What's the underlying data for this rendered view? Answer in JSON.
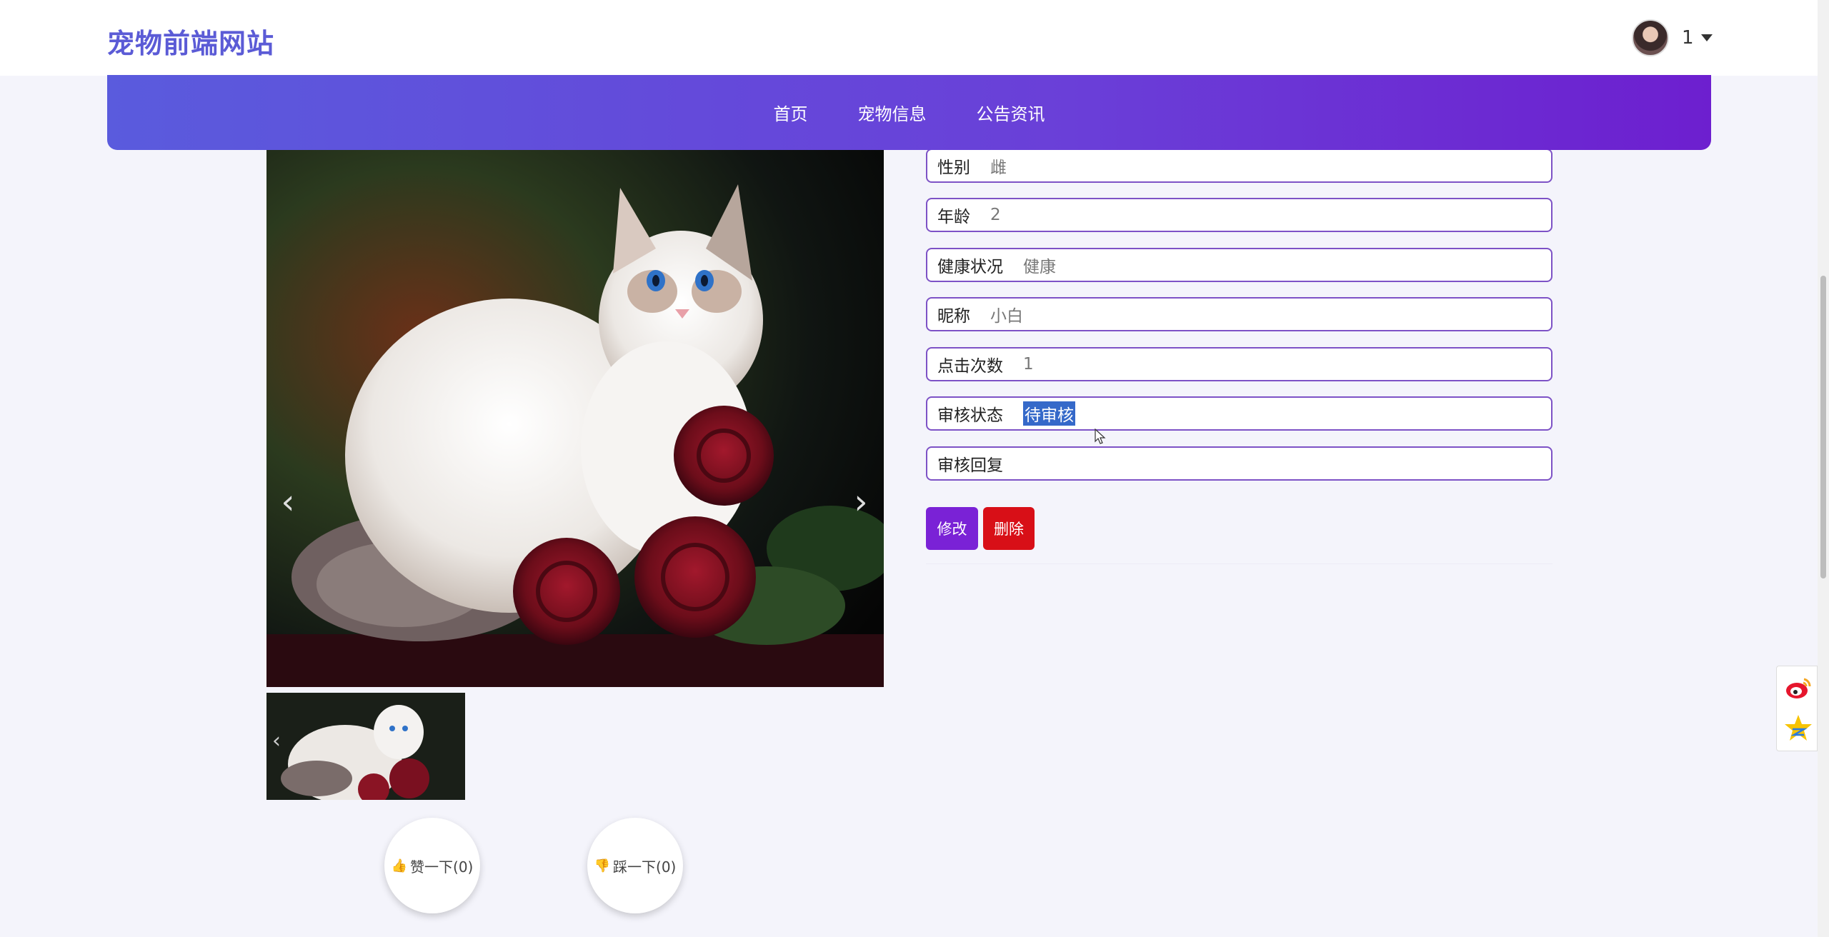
{
  "header": {
    "site_title": "宠物前端网站",
    "username": "1"
  },
  "nav": {
    "items": [
      {
        "label": "首页"
      },
      {
        "label": "宠物信息"
      },
      {
        "label": "公告资讯"
      }
    ]
  },
  "pet_details": {
    "fields": [
      {
        "label": "性别",
        "value": "雌"
      },
      {
        "label": "年龄",
        "value": "2"
      },
      {
        "label": "健康状况",
        "value": "健康"
      },
      {
        "label": "昵称",
        "value": "小白"
      },
      {
        "label": "点击次数",
        "value": "1"
      },
      {
        "label": "审核状态",
        "value": "待审核"
      },
      {
        "label": "审核回复",
        "value": ""
      }
    ]
  },
  "actions": {
    "edit_label": "修改",
    "delete_label": "删除"
  },
  "votes": {
    "like_label": "赞一下(0)",
    "dislike_label": "踩一下(0)"
  },
  "colors": {
    "brand": "#5b5bd6",
    "nav_gradient_start": "#5a5bdd",
    "nav_gradient_end": "#6d1fcf",
    "field_border": "#7d52c6",
    "edit_button": "#7a22d6",
    "delete_button": "#d80f17",
    "selection": "#3569c9"
  },
  "icons": {
    "prev": "chevron-left-icon",
    "next": "chevron-right-icon",
    "like": "thumbs-up-icon",
    "dislike": "thumbs-down-icon",
    "weibo": "weibo-icon",
    "qzone": "qzone-star-icon"
  }
}
